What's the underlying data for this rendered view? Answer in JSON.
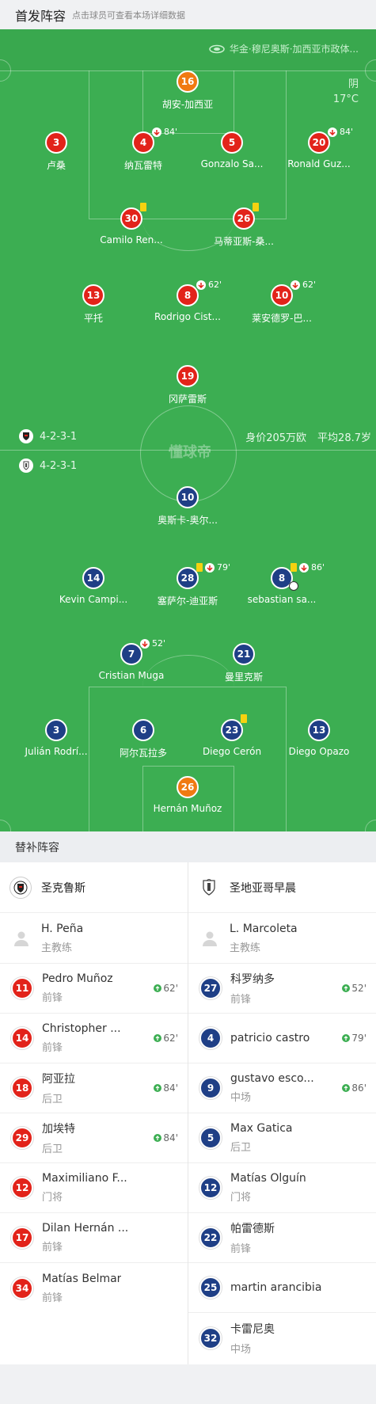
{
  "header": {
    "title": "首发阵容",
    "hint": "点击球员可查看本场详细数据"
  },
  "pitch": {
    "venue": "华金·穆尼奥斯·加西亚市政体...",
    "weather": {
      "condition": "阴",
      "temp": "17°C"
    },
    "watermark": "懂球帝",
    "home_formation": "4-2-3-1",
    "away_formation": "4-2-3-1",
    "value": "身价205万欧",
    "avg_age": "平均28.7岁",
    "home": [
      {
        "num": "16",
        "name": "胡安-加西亚",
        "gk": true
      },
      {
        "num": "3",
        "name": "卢桑"
      },
      {
        "num": "4",
        "name": "纳瓦雷特",
        "minute": "84'"
      },
      {
        "num": "5",
        "name": "Gonzalo Sa..."
      },
      {
        "num": "20",
        "name": "Ronald Guz...",
        "minute": "84'"
      },
      {
        "num": "30",
        "name": "Camilo Ren...",
        "yellow": true
      },
      {
        "num": "26",
        "name": "马蒂亚斯-桑...",
        "yellow": true
      },
      {
        "num": "13",
        "name": "平托"
      },
      {
        "num": "8",
        "name": "Rodrigo Cist...",
        "minute": "62'"
      },
      {
        "num": "10",
        "name": "莱安德罗-巴...",
        "minute": "62'"
      },
      {
        "num": "19",
        "name": "冈萨雷斯"
      }
    ],
    "away": [
      {
        "num": "10",
        "name": "奥斯卡-奥尔..."
      },
      {
        "num": "14",
        "name": "Kevin Campi..."
      },
      {
        "num": "28",
        "name": "塞萨尔-迪亚斯",
        "minute": "79'",
        "yellow": true
      },
      {
        "num": "8",
        "name": "sebastian sa...",
        "minute": "86'",
        "yellow": true,
        "goal": true
      },
      {
        "num": "7",
        "name": "Cristian Muga",
        "minute": "52'"
      },
      {
        "num": "21",
        "name": "曼里克斯"
      },
      {
        "num": "3",
        "name": "Julián Rodrí..."
      },
      {
        "num": "6",
        "name": "阿尔瓦拉多"
      },
      {
        "num": "23",
        "name": "Diego Cerón",
        "yellow": true
      },
      {
        "num": "13",
        "name": "Diego Opazo"
      },
      {
        "num": "26",
        "name": "Hernán Muñoz",
        "gk": true
      }
    ]
  },
  "subs": {
    "title": "替补阵容",
    "left": {
      "team": "圣克鲁斯",
      "coach": {
        "name": "H. Peña",
        "role": "主教练"
      },
      "players": [
        {
          "num": "11",
          "name": "Pedro Muñoz",
          "pos": "前锋",
          "in": "62'"
        },
        {
          "num": "14",
          "name": "Christopher ...",
          "pos": "前锋",
          "in": "62'"
        },
        {
          "num": "18",
          "name": "阿亚拉",
          "pos": "后卫",
          "in": "84'"
        },
        {
          "num": "29",
          "name": "加埃特",
          "pos": "后卫",
          "in": "84'"
        },
        {
          "num": "12",
          "name": "Maximiliano F...",
          "pos": "门将"
        },
        {
          "num": "17",
          "name": "Dilan Hernán ...",
          "pos": "前锋"
        },
        {
          "num": "34",
          "name": "Matías Belmar",
          "pos": "前锋"
        }
      ]
    },
    "right": {
      "team": "圣地亚哥早晨",
      "coach": {
        "name": "L. Marcoleta",
        "role": "主教练"
      },
      "players": [
        {
          "num": "27",
          "name": "科罗纳多",
          "pos": "前锋",
          "in": "52'"
        },
        {
          "num": "4",
          "name": "patricio castro",
          "pos": "",
          "in": "79'"
        },
        {
          "num": "9",
          "name": "gustavo esco...",
          "pos": "中场",
          "in": "86'"
        },
        {
          "num": "5",
          "name": "Max Gatica",
          "pos": "后卫"
        },
        {
          "num": "12",
          "name": "Matías Olguín",
          "pos": "门将"
        },
        {
          "num": "22",
          "name": "帕雷德斯",
          "pos": "前锋"
        },
        {
          "num": "25",
          "name": "martin arancibia",
          "pos": ""
        },
        {
          "num": "32",
          "name": "卡雷尼奥",
          "pos": "中场"
        }
      ]
    }
  },
  "colors": {
    "pitch": "#3cae52",
    "home": "#e2231a",
    "away": "#1f3f86",
    "keeper": "#f07a12",
    "yellow_card": "#f5d210"
  }
}
